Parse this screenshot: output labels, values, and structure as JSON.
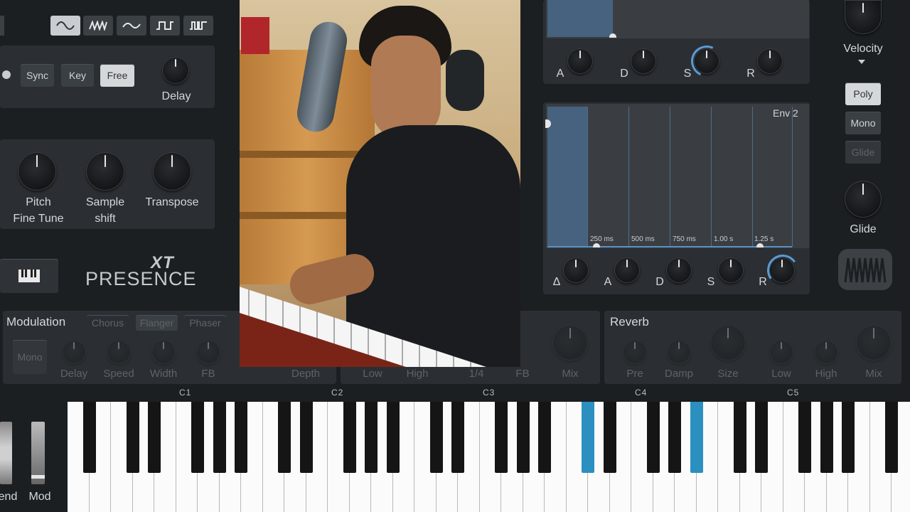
{
  "app": {
    "name": "Presence XT",
    "brand_top": "XT",
    "brand_bottom": "PRESENCE"
  },
  "lfo": {
    "waveforms": [
      "sine-wave-icon",
      "random-wave-icon",
      "triangle-wave-icon",
      "square-wave-icon",
      "pulse-wave-icon"
    ],
    "sync_buttons": [
      {
        "label": "Sync",
        "active": false
      },
      {
        "label": "Key",
        "active": false
      },
      {
        "label": "Free",
        "active": true
      }
    ],
    "delay_label": "Delay"
  },
  "pitch": {
    "knobs": [
      {
        "line1": "Pitch",
        "line2": "Fine Tune"
      },
      {
        "line1": "Sample",
        "line2": "shift"
      },
      {
        "line1": "Transpose",
        "line2": ""
      }
    ]
  },
  "env1": {
    "knobs": [
      "A",
      "D",
      "S",
      "R"
    ]
  },
  "env2": {
    "title": "Env 2",
    "time_labels": [
      "250 ms",
      "500 ms",
      "750 ms",
      "1.00 s",
      "1.25 s"
    ],
    "knobs": [
      "Δ",
      "A",
      "D",
      "S",
      "R"
    ]
  },
  "right_panel": {
    "velocity_label": "Velocity",
    "voice_modes": [
      {
        "label": "Poly",
        "active": true
      },
      {
        "label": "Mono",
        "active": false
      },
      {
        "label": "Glide",
        "active": false
      }
    ],
    "glide_label": "Glide"
  },
  "modulation": {
    "title": "Modulation",
    "tabs": [
      "Chorus",
      "Flanger",
      "Phaser"
    ],
    "mono_label": "Mono",
    "knob_labels": [
      "Delay",
      "Speed",
      "Width",
      "FB"
    ],
    "depth_label": "Depth"
  },
  "delay_fx": {
    "knob_labels": [
      "Low",
      "High",
      "1/4",
      "FB",
      "Mix"
    ]
  },
  "reverb": {
    "title": "Reverb",
    "knob_labels": [
      "Pre",
      "Damp",
      "Size",
      "Low",
      "High",
      "Mix"
    ]
  },
  "keyboard": {
    "octave_labels": [
      "C1",
      "C2",
      "C3",
      "C4",
      "C5"
    ],
    "wheels": [
      "end",
      "Mod"
    ],
    "highlighted_keys": [
      "C#4",
      "A#4"
    ]
  },
  "colors": {
    "accent": "#5b9bd5",
    "key_highlight": "#2b8fc0",
    "panel": "#2b2f33",
    "background": "#1c1f22"
  }
}
